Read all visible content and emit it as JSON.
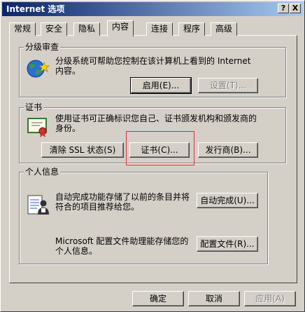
{
  "window": {
    "title": "Internet 选项",
    "help_label": "?",
    "close_label": "X"
  },
  "tabs": [
    "常规",
    "安全",
    "隐私",
    "内容",
    "连接",
    "程序",
    "高级"
  ],
  "content_advisor": {
    "title": "分级审查",
    "description_line1": "分级系统可帮助您控制在该计算机上看到的 Internet",
    "description_line2": "内容。",
    "enable_label": "启用(E)...",
    "settings_label": "设置(T)..."
  },
  "certificates": {
    "title": "证书",
    "description_line1": "使用证书可正确标识您自己、证书颁发机构和颁发商的",
    "description_line2": "身份。",
    "clear_ssl_label": "清除 SSL 状态(S)",
    "certificates_label": "证书(C)...",
    "publishers_label": "发行商(B)..."
  },
  "personal_info": {
    "title": "个人信息",
    "autocomplete_desc_line1": "自动完成功能存储了以前的条目并将",
    "autocomplete_desc_line2": "符合的项目推荐给您。",
    "autocomplete_label": "自动完成(U)...",
    "profile_desc_line1": "Microsoft 配置文件助理能存储您的",
    "profile_desc_line2": "个人信息。",
    "profile_label": "配置文件(R)..."
  },
  "footer": {
    "ok_label": "确定",
    "cancel_label": "取消",
    "apply_label": "应用(A)"
  },
  "icons": {
    "globe": "globe-star-icon",
    "certificate": "certificate-icon",
    "profile": "profile-card-icon"
  }
}
